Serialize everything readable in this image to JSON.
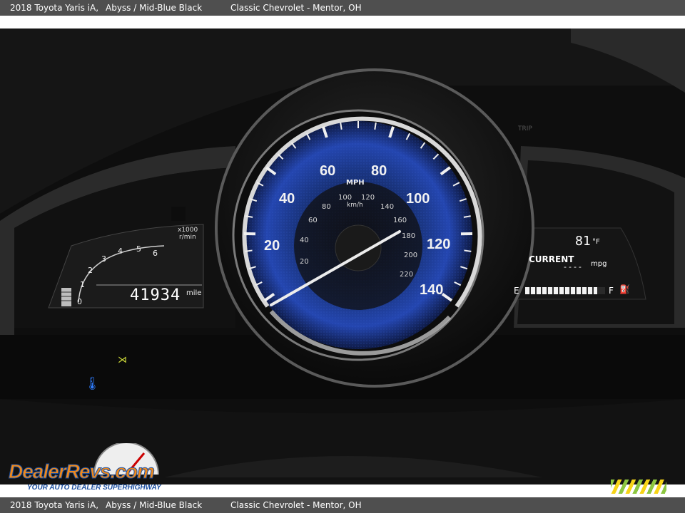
{
  "caption": {
    "vehicle": "2018 Toyota Yaris iA,",
    "colors": "Abyss / Mid-Blue Black",
    "dealer": "Classic Chevrolet - Mentor, OH"
  },
  "cluster": {
    "speedometer": {
      "mph_labels": [
        "20",
        "40",
        "60",
        "80",
        "100",
        "120",
        "140"
      ],
      "mph_unit": "MPH",
      "kmh_unit": "km/h",
      "kmh_labels": [
        "20",
        "40",
        "60",
        "80",
        "100",
        "120",
        "140",
        "160",
        "180",
        "200",
        "220"
      ],
      "needle_value_mph": 0
    },
    "tachometer": {
      "unit_top": "x1000",
      "unit_bottom": "r/min",
      "labels": [
        "0",
        "1",
        "2",
        "3",
        "4",
        "5",
        "6"
      ]
    },
    "odometer": {
      "value": "41934",
      "unit": "mile"
    },
    "fuel_info": {
      "outside_temp": "81",
      "temp_unit": "°F",
      "current_label": "CURRENT",
      "current_value": "----",
      "mpg_unit": "mpg",
      "empty_mark": "E",
      "full_mark": "F",
      "fuel_level": 0.9
    },
    "trip_label": "TRIP"
  },
  "watermark": {
    "brand": "DealerRevs.com",
    "tagline": "YOUR AUTO DEALER SUPERHIGHWAY"
  },
  "colors": {
    "gauge_blue": "#1f3fa0",
    "needle": "#e8e8e8",
    "lcd_text": "#ffffff",
    "caption_bar": "#4f4f4f",
    "logo_orange": "#f08a1c",
    "logo_blue": "#1c4fa0"
  }
}
